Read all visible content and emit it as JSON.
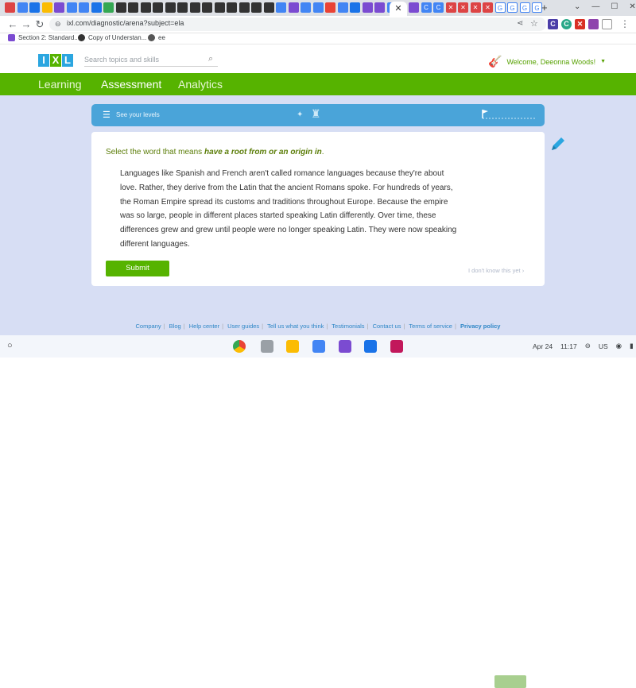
{
  "browser": {
    "active_tab_close": "✕",
    "new_tab": "+",
    "url": "ixl.com/diagnostic/arena?subject=ela",
    "tab_icon_colors": [
      "#d44",
      "#4285f4",
      "#1a73e8",
      "#fbbc04",
      "#7b4bd1",
      "#4285f4",
      "#4285f4",
      "#1a73e8",
      "#34a853",
      "#333",
      "#333",
      "#333",
      "#333",
      "#333",
      "#333",
      "#333",
      "#333",
      "#333",
      "#333",
      "#333",
      "#333",
      "#333",
      "#4285f4",
      "#7b4bd1",
      "#4285f4",
      "#4285f4",
      "#ea4335",
      "#4285f4",
      "#1a73e8",
      "#7b4bd1",
      "#7b4bd1",
      "#4285f4"
    ],
    "right_tab_icon_colors": [
      "#7b4bd1",
      "#4285f4",
      "#4285f4",
      "#d44",
      "#d44",
      "#d44",
      "#d44"
    ],
    "right_tab_letters": [
      "",
      "C",
      "C",
      "✕",
      "✕",
      "✕",
      "✕",
      "G",
      "G",
      "G",
      "G"
    ],
    "window_controls": [
      "⌄",
      "—",
      "☐",
      "✕"
    ]
  },
  "bookmarks": [
    {
      "label": "Section 2: Standard...",
      "color": "#7b4bd1"
    },
    {
      "label": "Copy of Understan...",
      "color": "#333"
    },
    {
      "label": "ee",
      "color": "#555"
    }
  ],
  "ixl": {
    "logo_letters": [
      "I",
      "X",
      "L"
    ],
    "search_placeholder": "Search topics and skills",
    "welcome": "Welcome, Deeonna Woods!",
    "nav": [
      "Learning",
      "Assessment",
      "Analytics"
    ]
  },
  "levels_label": "See your levels",
  "question": {
    "prefix": "Select the word that means ",
    "emphasis": "have a root from or an origin in",
    "suffix": "."
  },
  "passage": "Languages like Spanish and French aren't called romance languages because they're about love. Rather, they derive from the Latin that the ancient Romans spoke. For hundreds of years, the Roman Empire spread its customs and traditions throughout Europe. Because the empire was so large, people in different places started speaking Latin differently. Over time, these differences grew and grew until people were no longer speaking Latin. They were now speaking different languages.",
  "submit_label": "Submit",
  "dont_know": "I don't know this yet",
  "footer_links": [
    "Company",
    "Blog",
    "Help center",
    "User guides",
    "Tell us what you think",
    "Testimonials",
    "Contact us",
    "Terms of service"
  ],
  "footer_bold": "Privacy policy",
  "shelf": {
    "date": "Apr 24",
    "time": "11:17",
    "lang": "US"
  }
}
